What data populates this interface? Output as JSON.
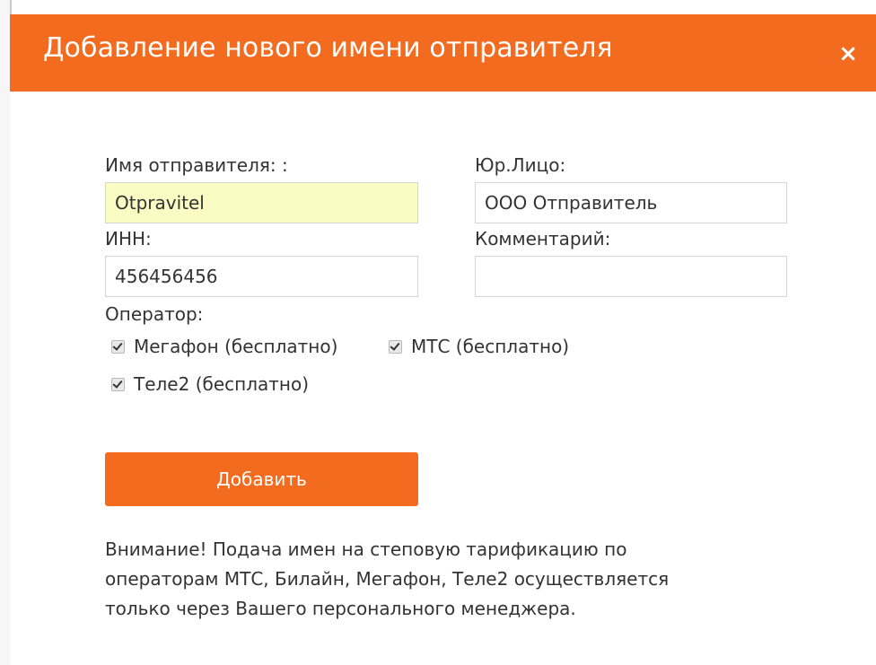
{
  "dialog": {
    "title": "Добавление нового имени отправителя",
    "close_label": "×"
  },
  "form": {
    "sender_name": {
      "label": "Имя отправителя: :",
      "value": "Otpravitel"
    },
    "legal_entity": {
      "label": "Юр.Лицо:",
      "value": "ООО Отправитель"
    },
    "inn": {
      "label": "ИНН:",
      "value": "456456456"
    },
    "comment": {
      "label": "Комментарий:",
      "value": ""
    },
    "operator_label": "Оператор:",
    "operators": [
      {
        "label": "Мегафон (бесплатно)",
        "checked": true
      },
      {
        "label": "МТС (бесплатно)",
        "checked": true
      },
      {
        "label": "Теле2 (бесплатно)",
        "checked": true
      }
    ],
    "submit_label": "Добавить"
  },
  "notice": {
    "line1": "Внимание! Подача имен на степовую тарификацию по",
    "line2": "операторам МТС, Билайн, Мегафон, Теле2 осуществляется",
    "line3": "только через Вашего персонального менеджера."
  },
  "colors": {
    "accent": "#f26b1f",
    "autofill": "#fbfbc4",
    "text": "#333333"
  }
}
